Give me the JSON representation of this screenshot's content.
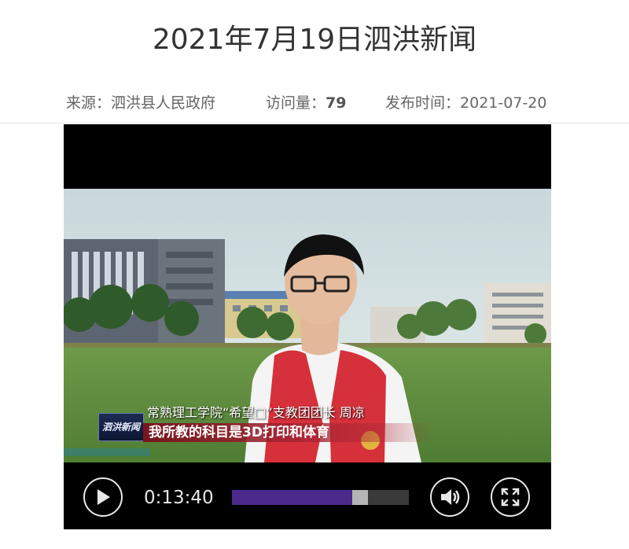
{
  "article": {
    "title": "2021年7月19日泗洪新闻",
    "meta": {
      "source_label": "来源：",
      "source_value": "泗洪县人民政府",
      "views_label": "访问量：",
      "views_value": "79",
      "date_label": "发布时间：",
      "date_value": "2021-07-20"
    }
  },
  "video": {
    "lower_third": {
      "logo_text": "泗洪新闻",
      "name_line": "常熟理工学院“希望□”支教团团长 周凉",
      "quote_line": "我所教的科目是3D打印和体育"
    },
    "controls": {
      "current_time": "0:13:40",
      "progress_fraction": 0.68,
      "buffered_fraction": 0.77,
      "play_icon": "play-icon",
      "volume_icon": "volume-icon",
      "fullscreen_icon": "fullscreen-icon"
    },
    "colors": {
      "progress_fill": "#4b2a8c",
      "buffer": "#b5b5b5",
      "lower_third_bar": "#8c1a2a"
    }
  }
}
